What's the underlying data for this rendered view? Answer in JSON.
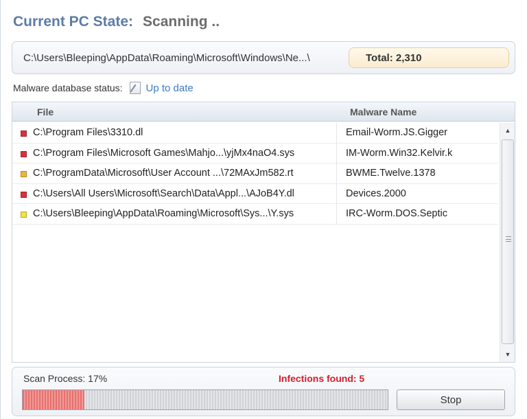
{
  "state": {
    "label": "Current PC State:",
    "value": "Scanning .."
  },
  "current_path": "C:\\Users\\Bleeping\\AppData\\Roaming\\Microsoft\\Windows\\Ne...\\",
  "total": "Total: 2,310",
  "db_status": {
    "label": "Malware database status:",
    "icon": "update-icon",
    "link": "Up to date"
  },
  "table": {
    "columns": [
      "File",
      "Malware Name"
    ],
    "rows": [
      {
        "severity_color": "#d8323a",
        "file": "C:\\Program Files\\3310.dl",
        "malware": "Email-Worm.JS.Gigger"
      },
      {
        "severity_color": "#d8323a",
        "file": "C:\\Program Files\\Microsoft Games\\Mahjo...\\yjMx4naO4.sys",
        "malware": "IM-Worm.Win32.Kelvir.k"
      },
      {
        "severity_color": "#f0b43a",
        "file": "C:\\ProgramData\\Microsoft\\User Account ...\\72MAxJm582.rt",
        "malware": "BWME.Twelve.1378"
      },
      {
        "severity_color": "#d8323a",
        "file": "C:\\Users\\All Users\\Microsoft\\Search\\Data\\Appl...\\AJoB4Y.dl",
        "malware": "Devices.2000"
      },
      {
        "severity_color": "#f5e23a",
        "file": "C:\\Users\\Bleeping\\AppData\\Roaming\\Microsoft\\Sys...\\Y.sys",
        "malware": "IRC-Worm.DOS.Septic"
      }
    ]
  },
  "scan": {
    "label": "Scan Process: 17%",
    "progress": 0.17,
    "infections": "Infections found: 5",
    "stop_label": "Stop"
  }
}
